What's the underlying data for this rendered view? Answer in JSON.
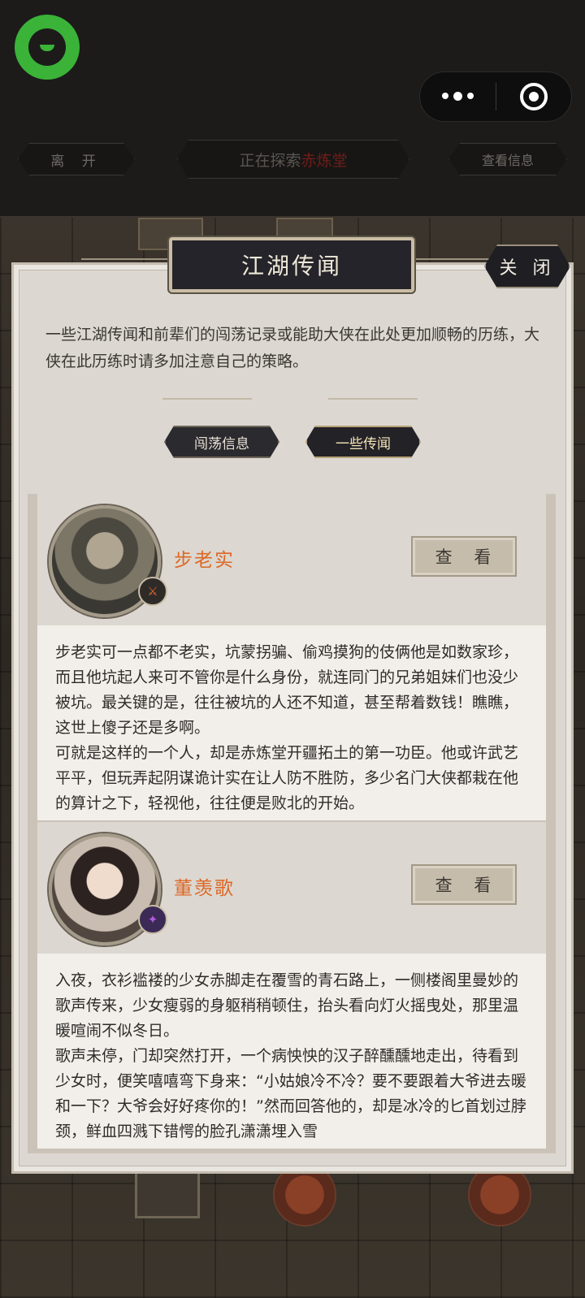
{
  "top": {
    "leave_label": "离 开",
    "exploring_prefix": "正在探索",
    "exploring_location": "赤炼堂",
    "view_info_label": "查看信息"
  },
  "modal": {
    "title": "江湖传闻",
    "close_label": "关 闭",
    "intro": "一些江湖传闻和前辈们的闯荡记录或能助大侠在此处更加顺畅的历练，大侠在此历练时请多加注意自己的策略。",
    "tabs": [
      {
        "label": "闯荡信息",
        "active": false
      },
      {
        "label": "一些传闻",
        "active": true
      }
    ]
  },
  "entries": [
    {
      "name": "步老实",
      "view_label": "查 看",
      "paragraphs": [
        "步老实可一点都不老实，坑蒙拐骗、偷鸡摸狗的伎俩他是如数家珍，而且他坑起人来可不管你是什么身份，就连同门的兄弟姐妹们也没少被坑。最关键的是，往往被坑的人还不知道，甚至帮着数钱！瞧瞧，这世上傻子还是多啊。",
        "可就是这样的一个人，却是赤炼堂开疆拓土的第一功臣。他或许武艺平平，但玩弄起阴谋诡计实在让人防不胜防，多少名门大侠都栽在他的算计之下，轻视他，往往便是败北的开始。"
      ]
    },
    {
      "name": "董羡歌",
      "view_label": "查 看",
      "paragraphs": [
        "入夜，衣衫褴褛的少女赤脚走在覆雪的青石路上，一侧楼阁里曼妙的歌声传来，少女瘦弱的身躯稍稍顿住，抬头看向灯火摇曳处，那里温暖喧闹不似冬日。",
        "歌声未停，门却突然打开，一个病怏怏的汉子醉醺醺地走出，待看到少女时，便笑嘻嘻弯下身来：“小姑娘冷不冷？要不要跟着大爷进去暖和一下？大爷会好好疼你的！”然而回答他的，却是冰冷的匕首划过脖颈，鲜血四溅下错愕的脸孔潇潇埋入雪"
      ]
    }
  ],
  "colors": {
    "accent_name": "#dc6826",
    "location_red": "#6e1d19",
    "logo_green": "#3ab338"
  }
}
